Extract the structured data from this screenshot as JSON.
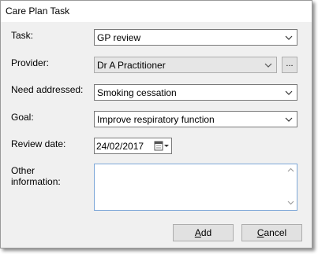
{
  "window": {
    "title": "Care Plan Task"
  },
  "form": {
    "task": {
      "label": "Task:",
      "value": "GP review"
    },
    "provider": {
      "label": "Provider:",
      "value": "Dr A Practitioner",
      "browse_label": "..."
    },
    "need": {
      "label": "Need addressed:",
      "value": "Smoking cessation"
    },
    "goal": {
      "label": "Goal:",
      "value": "Improve respiratory function"
    },
    "review_date": {
      "label": "Review date:",
      "value": "24/02/2017"
    },
    "other": {
      "label_line1": "Other",
      "label_line2": "information:",
      "value": ""
    }
  },
  "buttons": {
    "add_mnemonic": "A",
    "add_rest": "dd",
    "cancel_mnemonic": "C",
    "cancel_rest": "ancel"
  },
  "icons": {
    "combo_arrow": "chevron-down-icon",
    "calendar": "calendar-icon",
    "scroll_up": "scroll-up-icon",
    "scroll_down": "scroll-down-icon"
  },
  "colors": {
    "dialog_bg": "#f0f0f0",
    "focus_border": "#7ea8d8",
    "disabled_bg": "#e6e6e6"
  }
}
